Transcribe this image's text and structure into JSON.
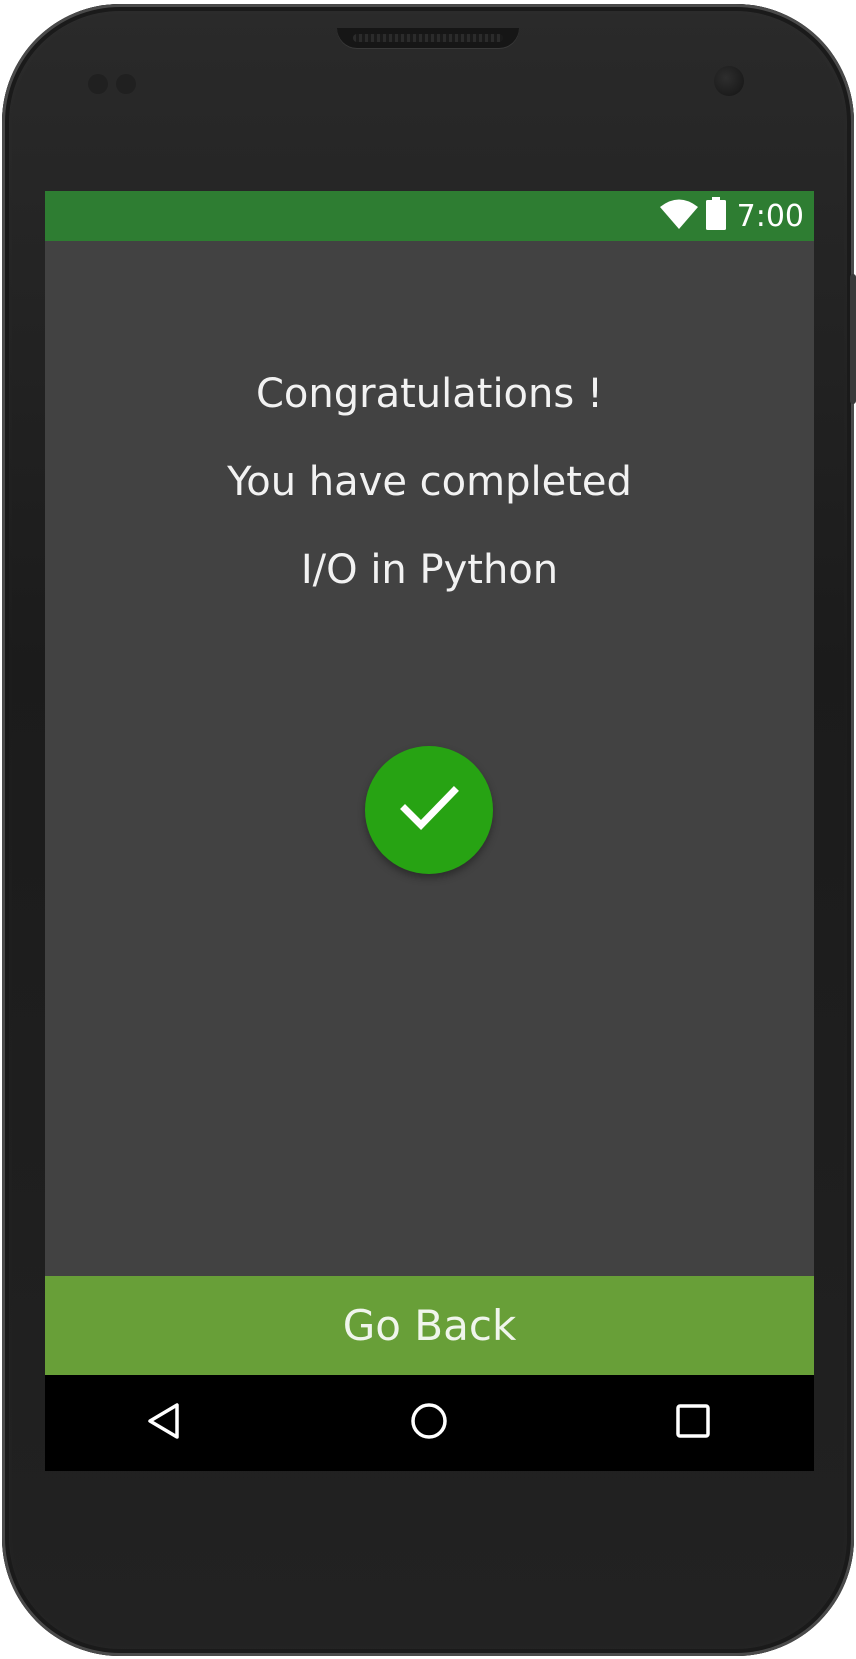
{
  "status_bar": {
    "time": "7:00",
    "icons": [
      "wifi-icon",
      "battery-icon"
    ],
    "background": "#2e7d32"
  },
  "message": {
    "line1": "Congratulations !",
    "line2": "You have completed",
    "line3": "I/O in Python"
  },
  "success_badge": {
    "icon": "checkmark-icon",
    "color": "#27a313"
  },
  "action": {
    "go_back_label": "Go Back",
    "color": "#689f38"
  },
  "nav_bar": {
    "items": [
      "back-icon",
      "home-icon",
      "recent-apps-icon"
    ]
  },
  "colors": {
    "screen_background": "#424242"
  }
}
